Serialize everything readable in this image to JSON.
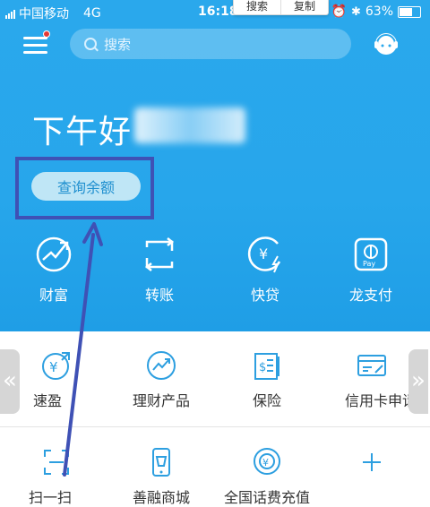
{
  "status": {
    "carrier": "中国移动",
    "network": "4G",
    "time": "16:18",
    "battery": "63%"
  },
  "context_menu": {
    "items": [
      "搜索",
      "复制"
    ]
  },
  "search": {
    "placeholder": "搜索"
  },
  "greeting": "下午好",
  "balance_button": "查询余额",
  "main_features": [
    "财富",
    "转账",
    "快贷",
    "龙支付"
  ],
  "services_row1": [
    "速盈",
    "理财产品",
    "保险",
    "信用卡申请"
  ],
  "services_row2": [
    "扫一扫",
    "善融商城",
    "全国话费充值"
  ],
  "icon_text": {
    "yen": "¥",
    "pay": "Pay"
  },
  "side_arrows": {
    "left": "«",
    "right": "»"
  },
  "colors": {
    "hero_bg": "#2aa8ec",
    "icon_blue": "#2d9fe0",
    "annotation": "#3f51b5"
  }
}
